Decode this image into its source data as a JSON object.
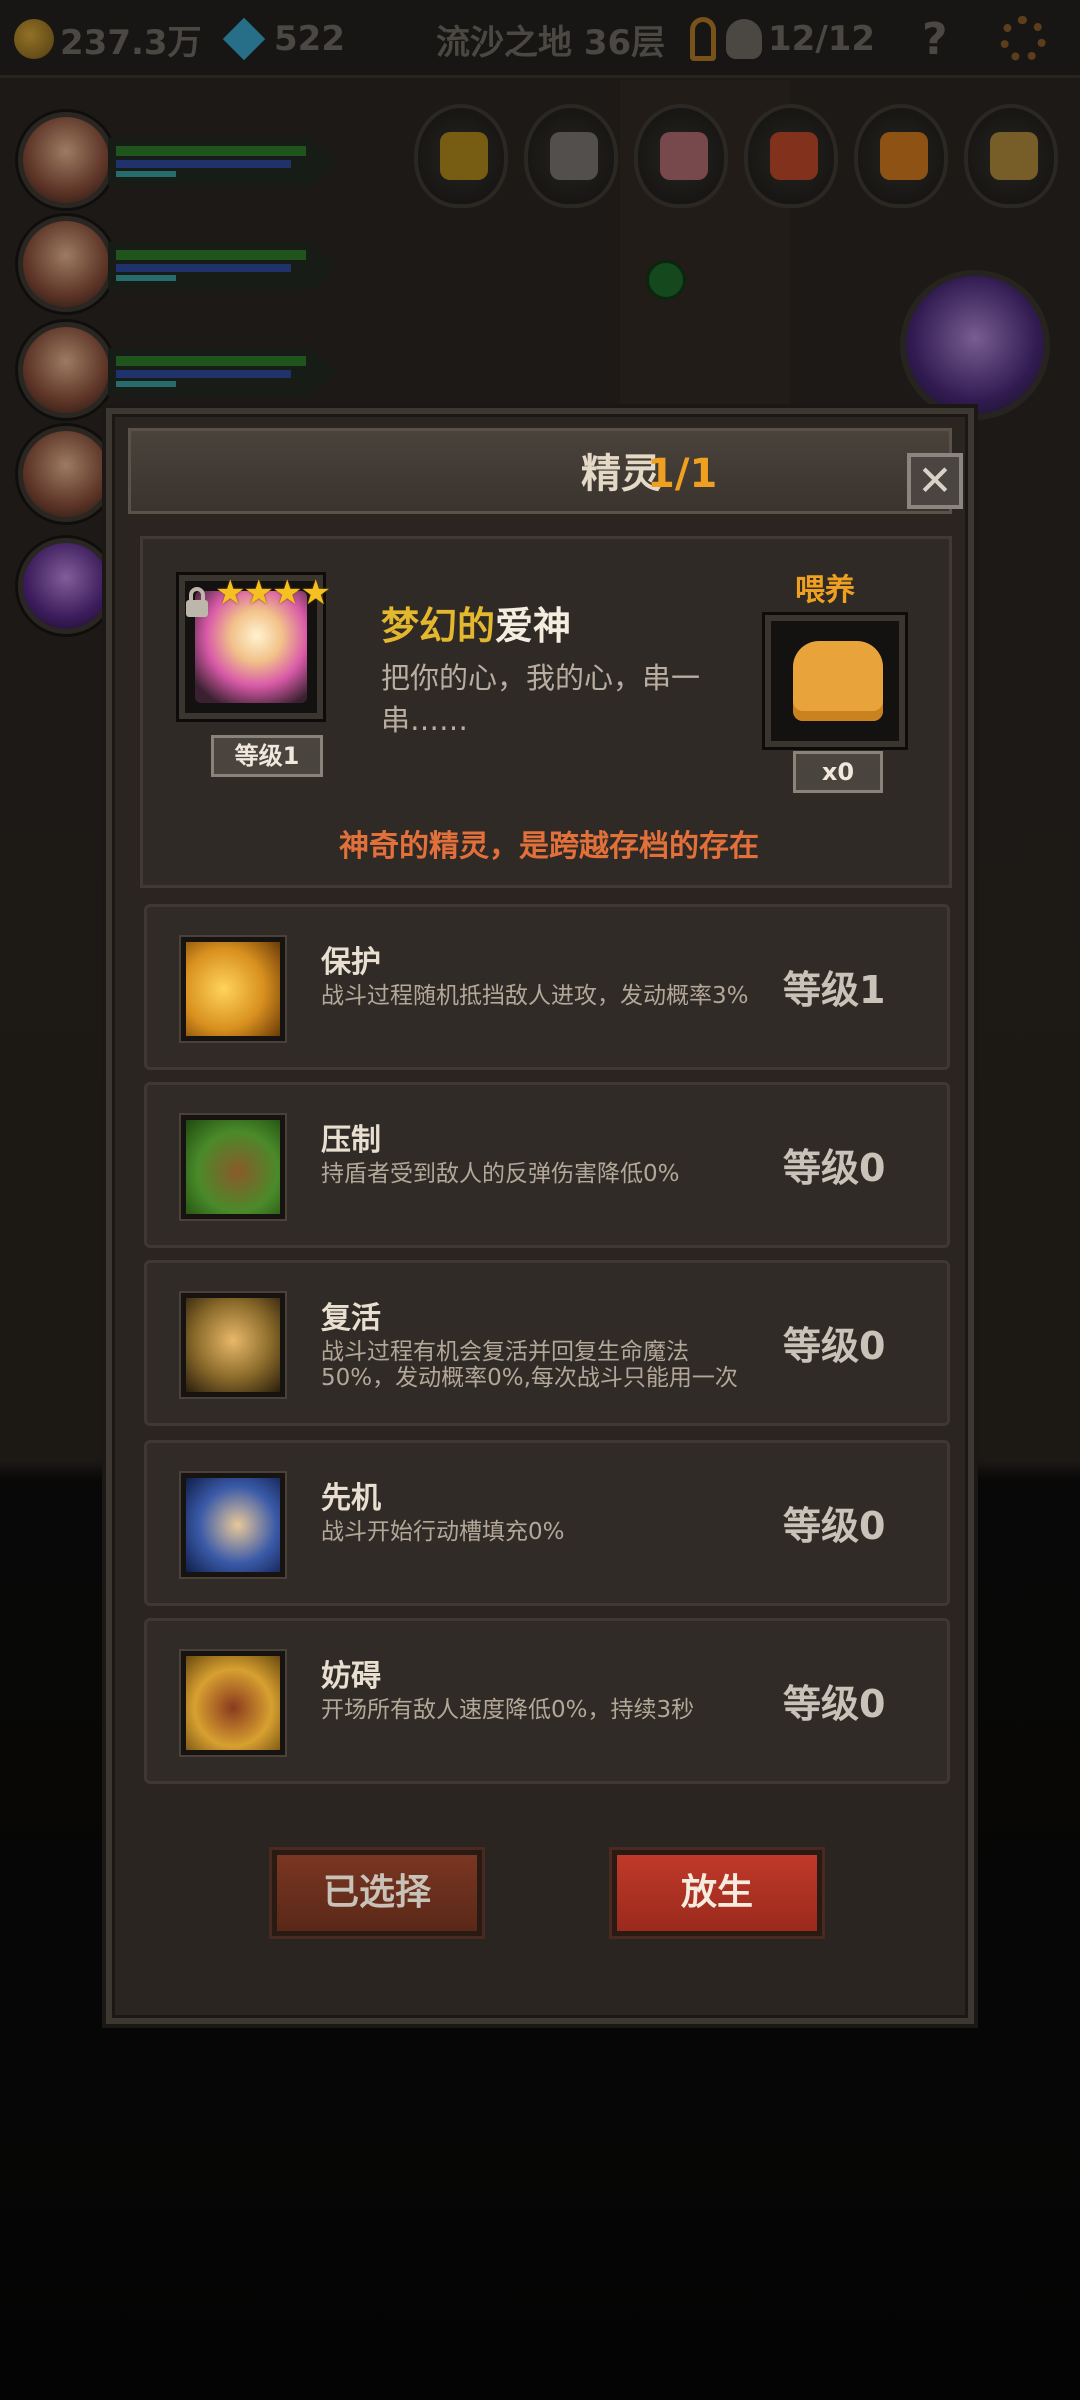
{
  "topbar": {
    "gold": "237.3万",
    "gems": "522",
    "stage": "流沙之地 36层",
    "kills": "12/12",
    "help": "?"
  },
  "modal": {
    "title": "精灵",
    "count": "1/1",
    "close": "✕"
  },
  "spirit": {
    "stars": "★★★★",
    "level": "等级1",
    "name_part1": "梦幻的",
    "name_part2": "爱神",
    "description": "把你的心，我的心，串一串……",
    "feed_label": "喂养",
    "feed_count": "x0",
    "tagline": "神奇的精灵，是跨越存档的存在"
  },
  "skills": [
    {
      "name": "保护",
      "desc": "战斗过程随机抵挡敌人进攻，发动概率3%",
      "level": "等级1",
      "icon": "dodge-icon",
      "color": "#d8901e"
    },
    {
      "name": "压制",
      "desc": "持盾者受到敌人的反弹伤害降低0%",
      "level": "等级0",
      "icon": "claw-icon",
      "color": "#4a8a2a"
    },
    {
      "name": "复活",
      "desc": "战斗过程有机会复活并回复生命魔法50%，发动概率0%,每次战斗只能用一次",
      "level": "等级0",
      "icon": "revive-icon",
      "color": "#8a6a2a"
    },
    {
      "name": "先机",
      "desc": "战斗开始行动槽填充0%",
      "level": "等级0",
      "icon": "leopard-icon",
      "color": "#3a5aa8"
    },
    {
      "name": "妨碍",
      "desc": "开场所有敌人速度降低0%，持续3秒",
      "level": "等级0",
      "icon": "chain-boot-icon",
      "color": "#d8a030"
    }
  ],
  "buttons": {
    "selected": "已选择",
    "release": "放生"
  }
}
